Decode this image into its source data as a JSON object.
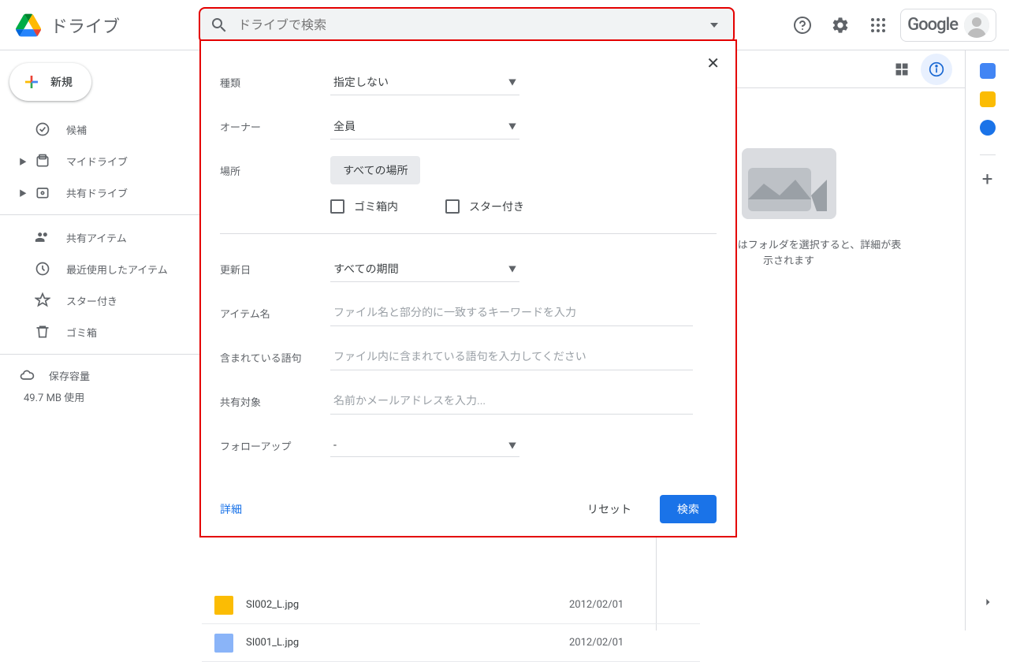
{
  "header": {
    "app_title": "ドライブ",
    "search_placeholder": "ドライブで検索",
    "google_label": "Google"
  },
  "sidebar": {
    "new_label": "新規",
    "items": [
      {
        "label": "候補"
      },
      {
        "label": "マイドライブ"
      },
      {
        "label": "共有ドライブ"
      },
      {
        "label": "共有アイテム"
      },
      {
        "label": "最近使用したアイテム"
      },
      {
        "label": "スター付き"
      },
      {
        "label": "ゴミ箱"
      }
    ],
    "storage_label": "保存容量",
    "storage_usage": "49.7 MB 使用"
  },
  "files": [
    {
      "name": "SI002_L.jpg",
      "date": "2012/02/01",
      "color": "#fbbc04"
    },
    {
      "name": "SI001_L.jpg",
      "date": "2012/02/01",
      "color": "#8ab4f8"
    }
  ],
  "rpanel": {
    "text": "ファイルまたはフォルダを選択すると、詳細が表示されます"
  },
  "search_panel": {
    "type_label": "種類",
    "type_value": "指定しない",
    "owner_label": "オーナー",
    "owner_value": "全員",
    "location_label": "場所",
    "location_value": "すべての場所",
    "trash_label": "ゴミ箱内",
    "starred_label": "スター付き",
    "modified_label": "更新日",
    "modified_value": "すべての期間",
    "itemname_label": "アイテム名",
    "itemname_placeholder": "ファイル名と部分的に一致するキーワードを入力",
    "words_label": "含まれている語句",
    "words_placeholder": "ファイル内に含まれている語句を入力してください",
    "shared_label": "共有対象",
    "shared_placeholder": "名前かメールアドレスを入力...",
    "followup_label": "フォローアップ",
    "followup_value": "-",
    "details_link": "詳細",
    "reset_label": "リセット",
    "search_label": "検索"
  }
}
